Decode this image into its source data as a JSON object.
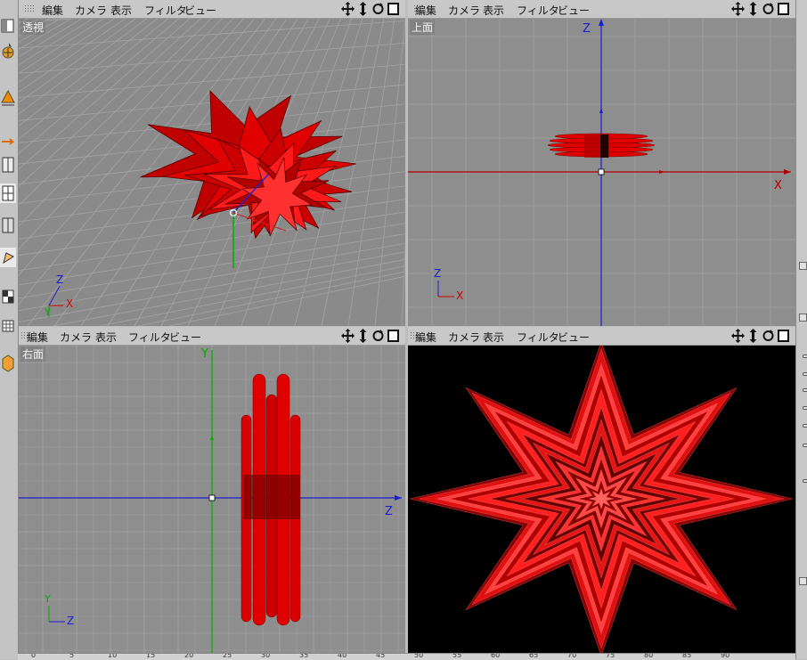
{
  "menu": [
    "編集",
    "カメラ",
    "表示",
    "フィルタ",
    "ビュー"
  ],
  "viewports": {
    "perspective": {
      "label": "透視"
    },
    "top": {
      "label": "上面",
      "axis_vertical": "Z",
      "axis_horizontal": "X"
    },
    "right": {
      "label": "右面",
      "axis_vertical": "Y",
      "axis_horizontal": "Z"
    },
    "render": {
      "label": ""
    }
  },
  "axis_gizmo": {
    "perspective": [
      "Z",
      "X",
      "Y"
    ],
    "top": [
      "Z",
      "X"
    ],
    "right": [
      "Y",
      "Z"
    ]
  },
  "ruler_ticks": [
    "0",
    "5",
    "10",
    "15",
    "20",
    "25",
    "30",
    "35",
    "40",
    "45",
    "50",
    "55",
    "60",
    "65",
    "70",
    "75",
    "80",
    "85",
    "90"
  ],
  "colors": {
    "object_red": "#d50000",
    "x_axis": "#b00000",
    "y_axis": "#00b000",
    "z_axis": "#1d1dd0",
    "grid_bg": "#8d8d8d"
  },
  "icons": [
    "move-view-icon",
    "scroll-view-icon",
    "rotate-view-icon",
    "maximize-view-icon"
  ]
}
